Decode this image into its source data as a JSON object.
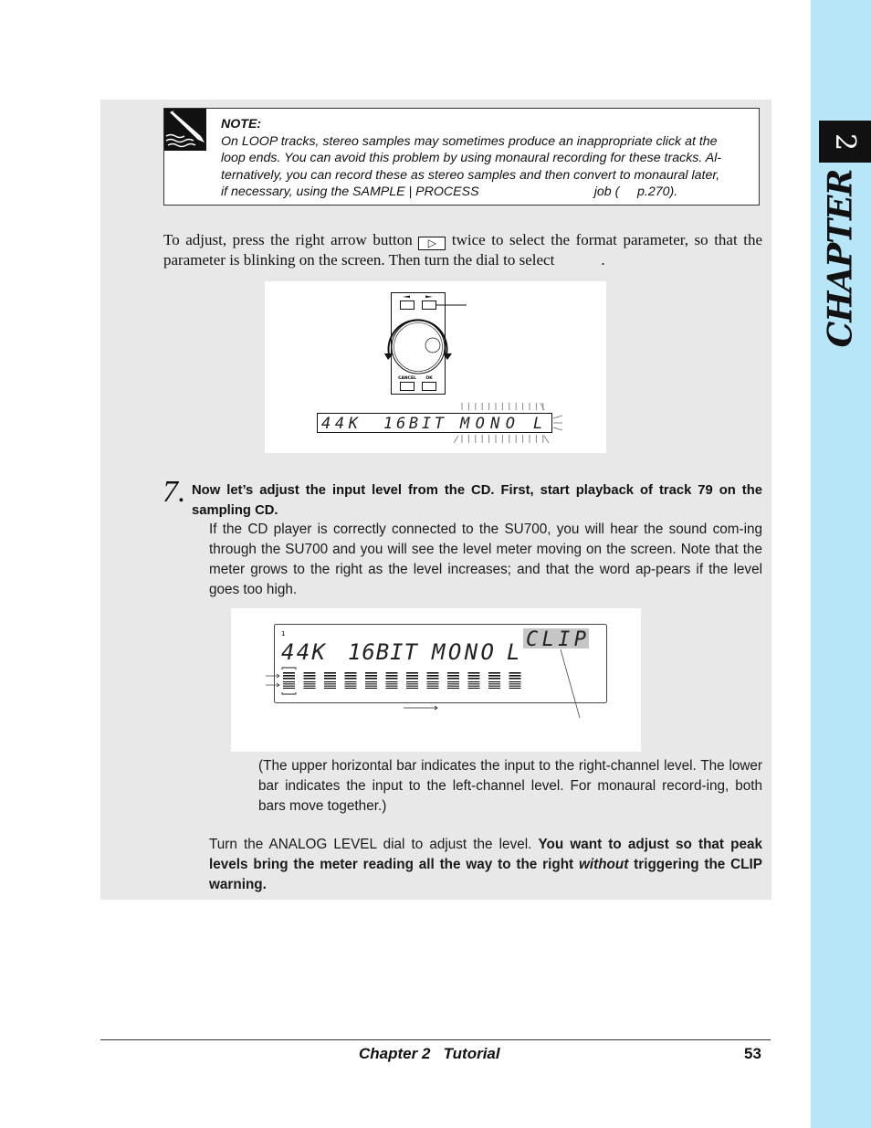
{
  "side_tab": {
    "chapter_number": "2",
    "chapter_word": "CHAPTER",
    "background_color": "#b7e6f8"
  },
  "note": {
    "icon": "pencil-note-icon",
    "title": "NOTE:",
    "lines": [
      "On LOOP tracks, stereo samples may sometimes produce an inappropriate click at the",
      "loop ends. You can avoid this problem by using monaural recording for these tracks. Al-",
      "ternatively, you can record these as stereo samples and then convert to monaural later,",
      "if necessary, using the SAMPLE | PROCESS                                job (     p.270)."
    ]
  },
  "instruction": {
    "before_button": "To adjust, press the right arrow button ",
    "button_glyph": "▷",
    "after_button": " twice to select the format parameter, so that the parameter is blinking on the screen. Then turn the dial to select",
    "end": "            ."
  },
  "figure1": {
    "cancel_label": "CANCEL",
    "ok_label": "OK",
    "lcd": {
      "rate": "44K",
      "bits": "16BIT",
      "mode": "MONO",
      "channel": "L"
    }
  },
  "step7": {
    "number": "7.",
    "heading": "Now let’s adjust the input level from the CD. First, start playback of track 79 on the sampling CD.",
    "body": "If the CD player is correctly connected to the SU700, you will hear the sound com-ing through the SU700 and you will see the level meter moving on the screen. Note that the meter grows to the right as the level increases; and that the word             ap-pears if the level goes too high."
  },
  "figure2": {
    "track_index": "1",
    "lcd": {
      "rate": "44K",
      "bits": "16BIT",
      "mode": "MONO",
      "channel": "L",
      "clip": "CLIP"
    },
    "meter_segments": 12
  },
  "bars_note": "(The upper horizontal bar indicates the input to the right-channel level. The lower bar indicates the input to the left-channel level. For monaural record-ing, both bars move together.)",
  "adjust": {
    "plain": "Turn the ANALOG LEVEL dial to adjust the level. ",
    "bold1": "You want to adjust so that peak levels bring the meter reading all the way to the right ",
    "italic": "without",
    "bold2": " triggering the CLIP warning."
  },
  "footer": {
    "chapter": "Chapter 2   Tutorial",
    "page": "53"
  }
}
